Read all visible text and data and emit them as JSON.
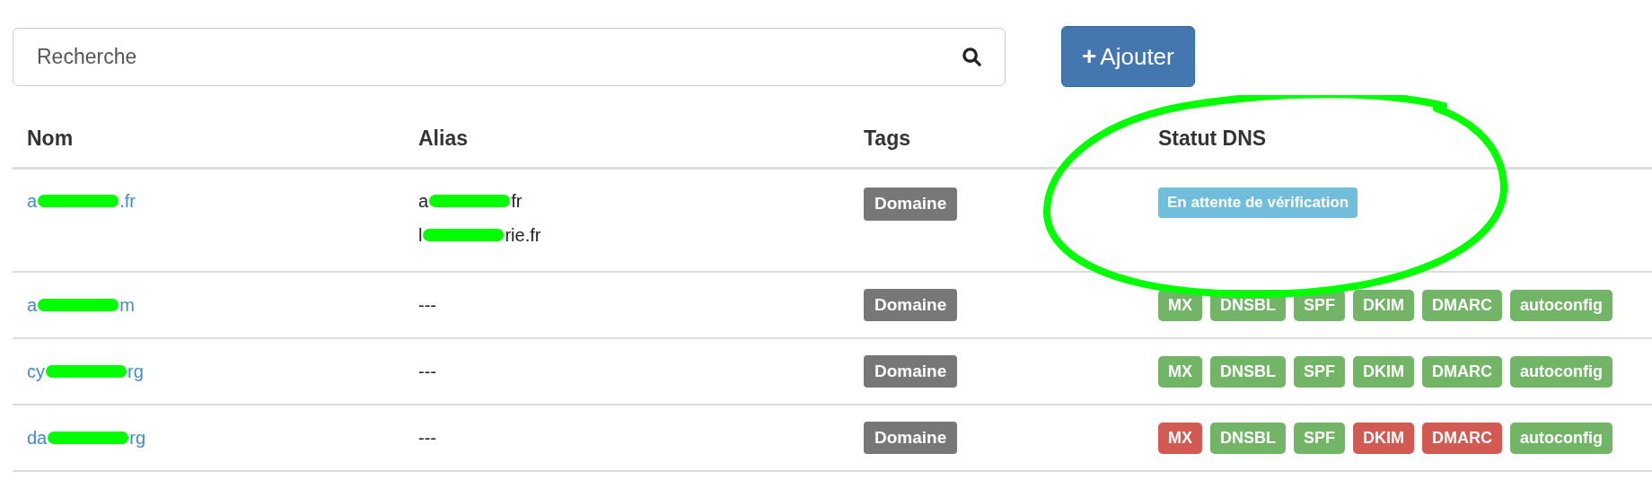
{
  "search": {
    "placeholder": "Recherche"
  },
  "add_button": {
    "icon": "+",
    "label": "Ajouter"
  },
  "table": {
    "columns": [
      "Nom",
      "Alias",
      "Tags",
      "Statut DNS"
    ],
    "rows": [
      {
        "name": {
          "start": "a",
          "end": ".fr"
        },
        "aliases": [
          {
            "start": "a",
            "end": "fr"
          },
          {
            "start": "l",
            "end": "rie.fr"
          }
        ],
        "tag": "Domaine",
        "dns": {
          "kind": "pending",
          "label": "En attente de vérification"
        }
      },
      {
        "name": {
          "start": "a",
          "end": "m"
        },
        "alias_text": "---",
        "tag": "Domaine",
        "dns": {
          "kind": "checks",
          "checks": [
            {
              "label": "MX",
              "ok": true
            },
            {
              "label": "DNSBL",
              "ok": true
            },
            {
              "label": "SPF",
              "ok": true
            },
            {
              "label": "DKIM",
              "ok": true
            },
            {
              "label": "DMARC",
              "ok": true
            },
            {
              "label": "autoconfig",
              "ok": true
            }
          ]
        }
      },
      {
        "name": {
          "start": "cy",
          "end": "rg"
        },
        "alias_text": "---",
        "tag": "Domaine",
        "dns": {
          "kind": "checks",
          "checks": [
            {
              "label": "MX",
              "ok": true
            },
            {
              "label": "DNSBL",
              "ok": true
            },
            {
              "label": "SPF",
              "ok": true
            },
            {
              "label": "DKIM",
              "ok": true
            },
            {
              "label": "DMARC",
              "ok": true
            },
            {
              "label": "autoconfig",
              "ok": true
            }
          ]
        }
      },
      {
        "name": {
          "start": "da",
          "end": "rg"
        },
        "alias_text": "---",
        "tag": "Domaine",
        "dns": {
          "kind": "checks",
          "checks": [
            {
              "label": "MX",
              "ok": false
            },
            {
              "label": "DNSBL",
              "ok": true
            },
            {
              "label": "SPF",
              "ok": true
            },
            {
              "label": "DKIM",
              "ok": false
            },
            {
              "label": "DMARC",
              "ok": false
            },
            {
              "label": "autoconfig",
              "ok": true
            }
          ]
        }
      }
    ]
  }
}
